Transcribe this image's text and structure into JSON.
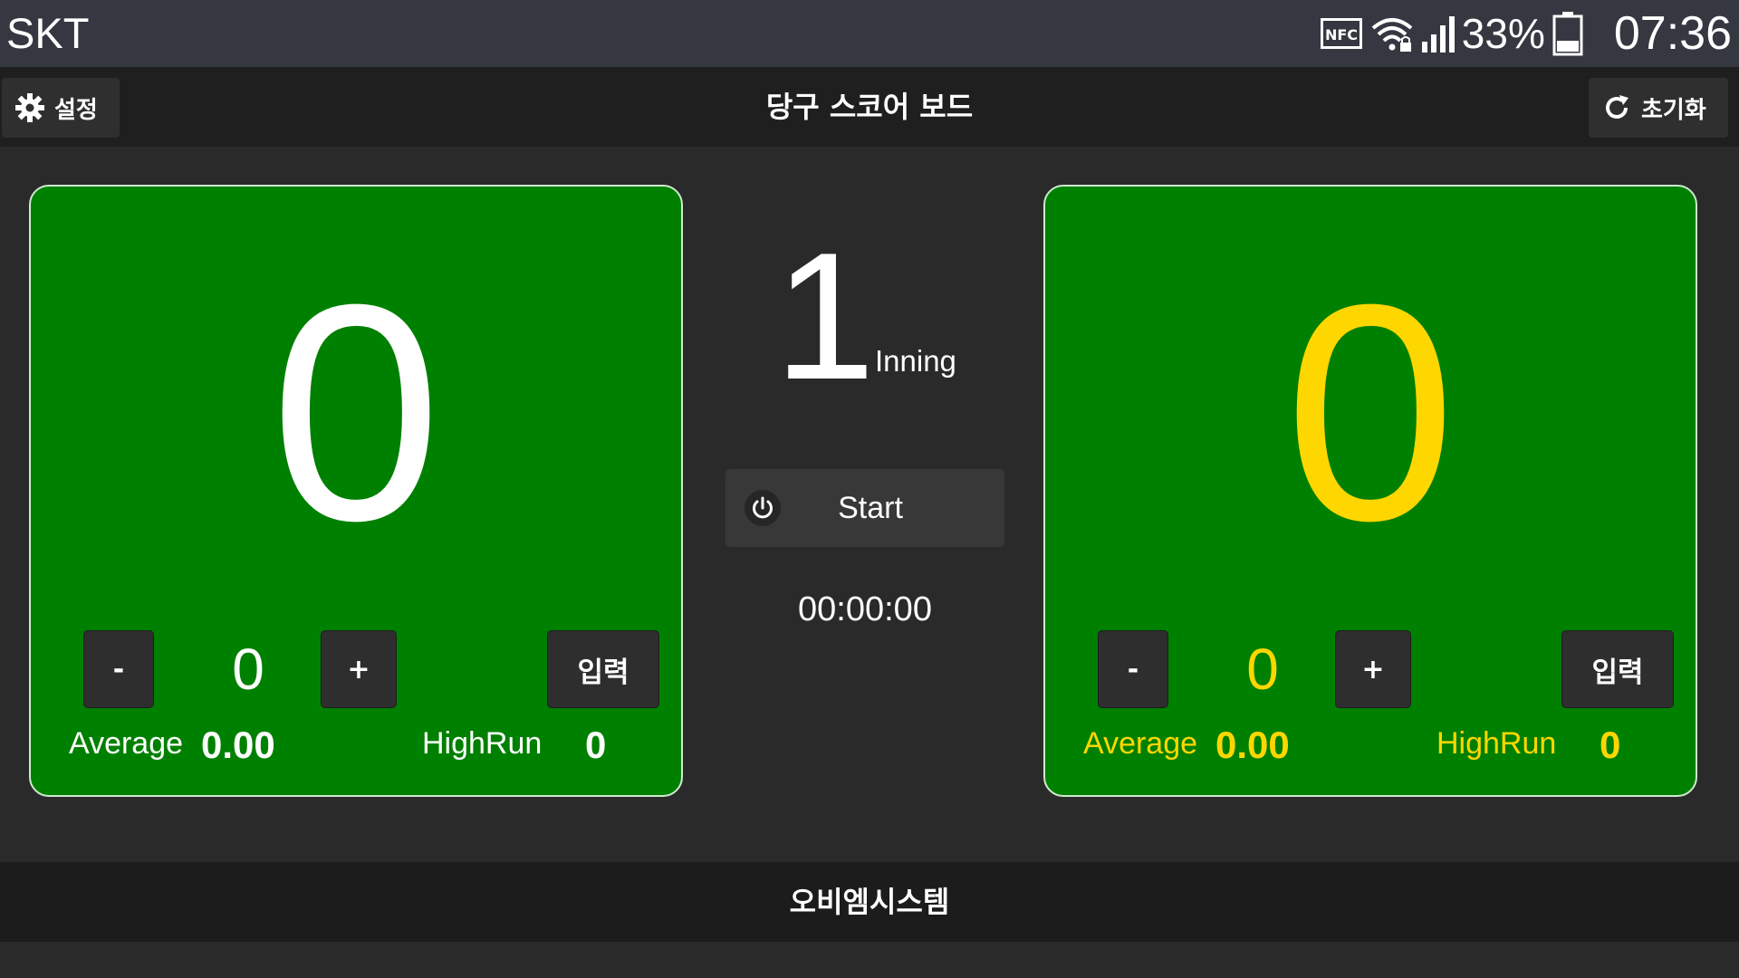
{
  "status_bar": {
    "carrier": "SKT",
    "nfc_label": "NFC",
    "battery_percent": "33%",
    "battery_level": 0.33,
    "time": "07:36"
  },
  "header": {
    "settings_label": "설정",
    "title": "당구 스코어 보드",
    "reset_label": "초기화"
  },
  "players": [
    {
      "score": "0",
      "turn_score": "0",
      "minus_label": "-",
      "plus_label": "+",
      "input_label": "입력",
      "average_label": "Average",
      "average_value": "0.00",
      "highrun_label": "HighRun",
      "highrun_value": "0",
      "text_color": "#ffffff"
    },
    {
      "score": "0",
      "turn_score": "0",
      "minus_label": "-",
      "plus_label": "+",
      "input_label": "입력",
      "average_label": "Average",
      "average_value": "0.00",
      "highrun_label": "HighRun",
      "highrun_value": "0",
      "text_color": "#ffd700"
    }
  ],
  "center": {
    "inning_number": "1",
    "inning_label": "Inning",
    "start_label": "Start",
    "timer": "00:00:00"
  },
  "footer": {
    "text": "오비엠시스템"
  },
  "colors": {
    "panel_green": "#008000",
    "player2_yellow": "#ffd700",
    "background": "#2a2a2a"
  }
}
